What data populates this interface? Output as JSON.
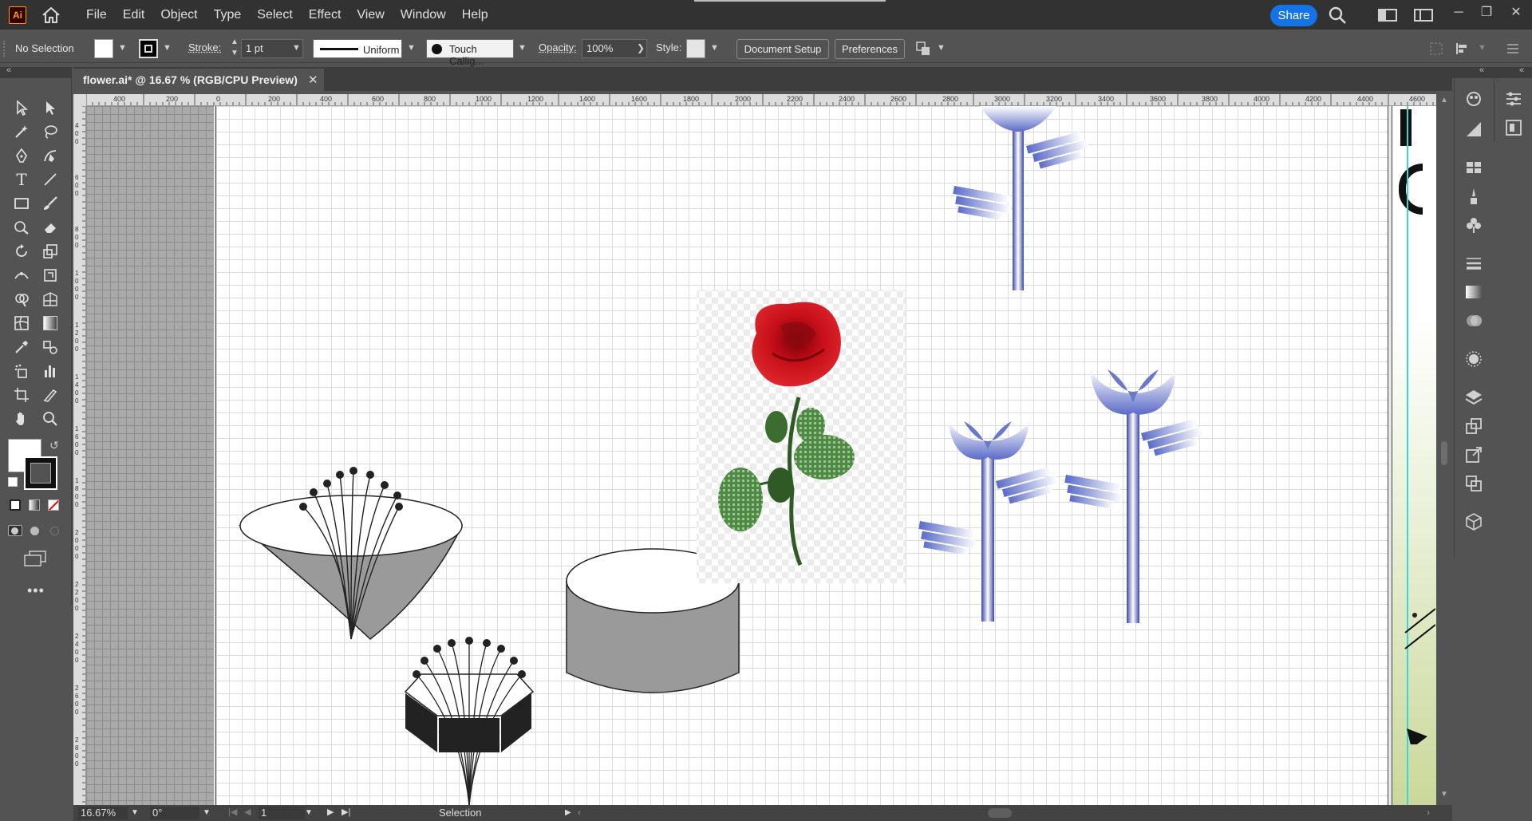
{
  "app": {
    "logo_text": "Ai"
  },
  "menu": [
    "File",
    "Edit",
    "Object",
    "Type",
    "Select",
    "Effect",
    "View",
    "Window",
    "Help"
  ],
  "share_label": "Share",
  "control": {
    "selection_status": "No Selection",
    "stroke_label": "Stroke:",
    "stroke_weight": "1 pt",
    "profile": "Uniform",
    "brush": "Touch Callig...",
    "opacity_label": "Opacity:",
    "opacity_value": "100%",
    "style_label": "Style:",
    "document_setup": "Document Setup",
    "preferences": "Preferences"
  },
  "document": {
    "tab_title": "flower.ai* @ 16.67 % (RGB/CPU Preview)",
    "close_glyph": "✕"
  },
  "ruler": {
    "top_ticks": [
      "400",
      "200",
      "0",
      "200",
      "400",
      "600",
      "800",
      "1000",
      "1200",
      "1400",
      "1600",
      "1800",
      "2000",
      "2200",
      "2400",
      "2600",
      "2800",
      "3000",
      "3200",
      "3400",
      "3600",
      "3800",
      "4000",
      "4200",
      "4400",
      "4600"
    ],
    "left_ticks": [
      "4 0 0",
      "6 0 0",
      "8 0 0",
      "1 0 0 0",
      "1 2 0 0",
      "1 4 0 0",
      "1 6 0 0",
      "1 8 0 0",
      "2 0 0 0",
      "2 2 0 0",
      "2 4 0 0",
      "2 6 0 0",
      "2 8 0 0"
    ]
  },
  "status": {
    "zoom": "16.67%",
    "rotation": "0°",
    "artboard_number": "1",
    "tool_name": "Selection"
  },
  "colors": {
    "ui_dark": "#323232",
    "ui_mid": "#535353",
    "accent": "#1473e6",
    "rose_red": "#c8101a",
    "flower_blue": "#6a78c8"
  }
}
